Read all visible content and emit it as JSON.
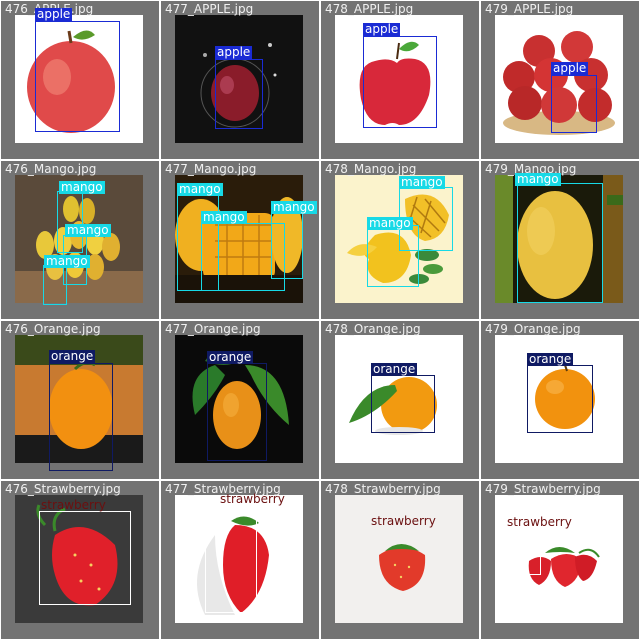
{
  "tiles": [
    {
      "filename": "476_APPLE.jpg",
      "labels": [
        "apple"
      ]
    },
    {
      "filename": "477_APPLE.jpg",
      "labels": [
        "apple"
      ]
    },
    {
      "filename": "478_APPLE.jpg",
      "labels": [
        "apple"
      ]
    },
    {
      "filename": "479_APPLE.jpg",
      "labels": [
        "apple"
      ]
    },
    {
      "filename": "476_Mango.jpg",
      "labels": [
        "mango",
        "mango",
        "mango"
      ]
    },
    {
      "filename": "477_Mango.jpg",
      "labels": [
        "mango",
        "mango",
        "mango"
      ]
    },
    {
      "filename": "478_Mango.jpg",
      "labels": [
        "mango",
        "mango"
      ]
    },
    {
      "filename": "479_Mango.jpg",
      "labels": [
        "mango"
      ]
    },
    {
      "filename": "476_Orange.jpg",
      "labels": [
        "orange"
      ]
    },
    {
      "filename": "477_Orange.jpg",
      "labels": [
        "orange"
      ]
    },
    {
      "filename": "478_Orange.jpg",
      "labels": [
        "orange"
      ]
    },
    {
      "filename": "479_Orange.jpg",
      "labels": [
        "orange"
      ]
    },
    {
      "filename": "476_Strawberry.jpg",
      "labels": [
        "strawberry"
      ]
    },
    {
      "filename": "477_Strawberry.jpg",
      "labels": [
        "strawberry"
      ]
    },
    {
      "filename": "478_Strawberry.jpg",
      "labels": [
        "strawberry"
      ]
    },
    {
      "filename": "479_Strawberry.jpg",
      "labels": [
        "strawberry"
      ]
    }
  ],
  "class_colors": {
    "apple": "#1a2bd4",
    "mango": "#17d9e6",
    "orange": "#0f1a63",
    "strawberry": "#ffffff"
  }
}
